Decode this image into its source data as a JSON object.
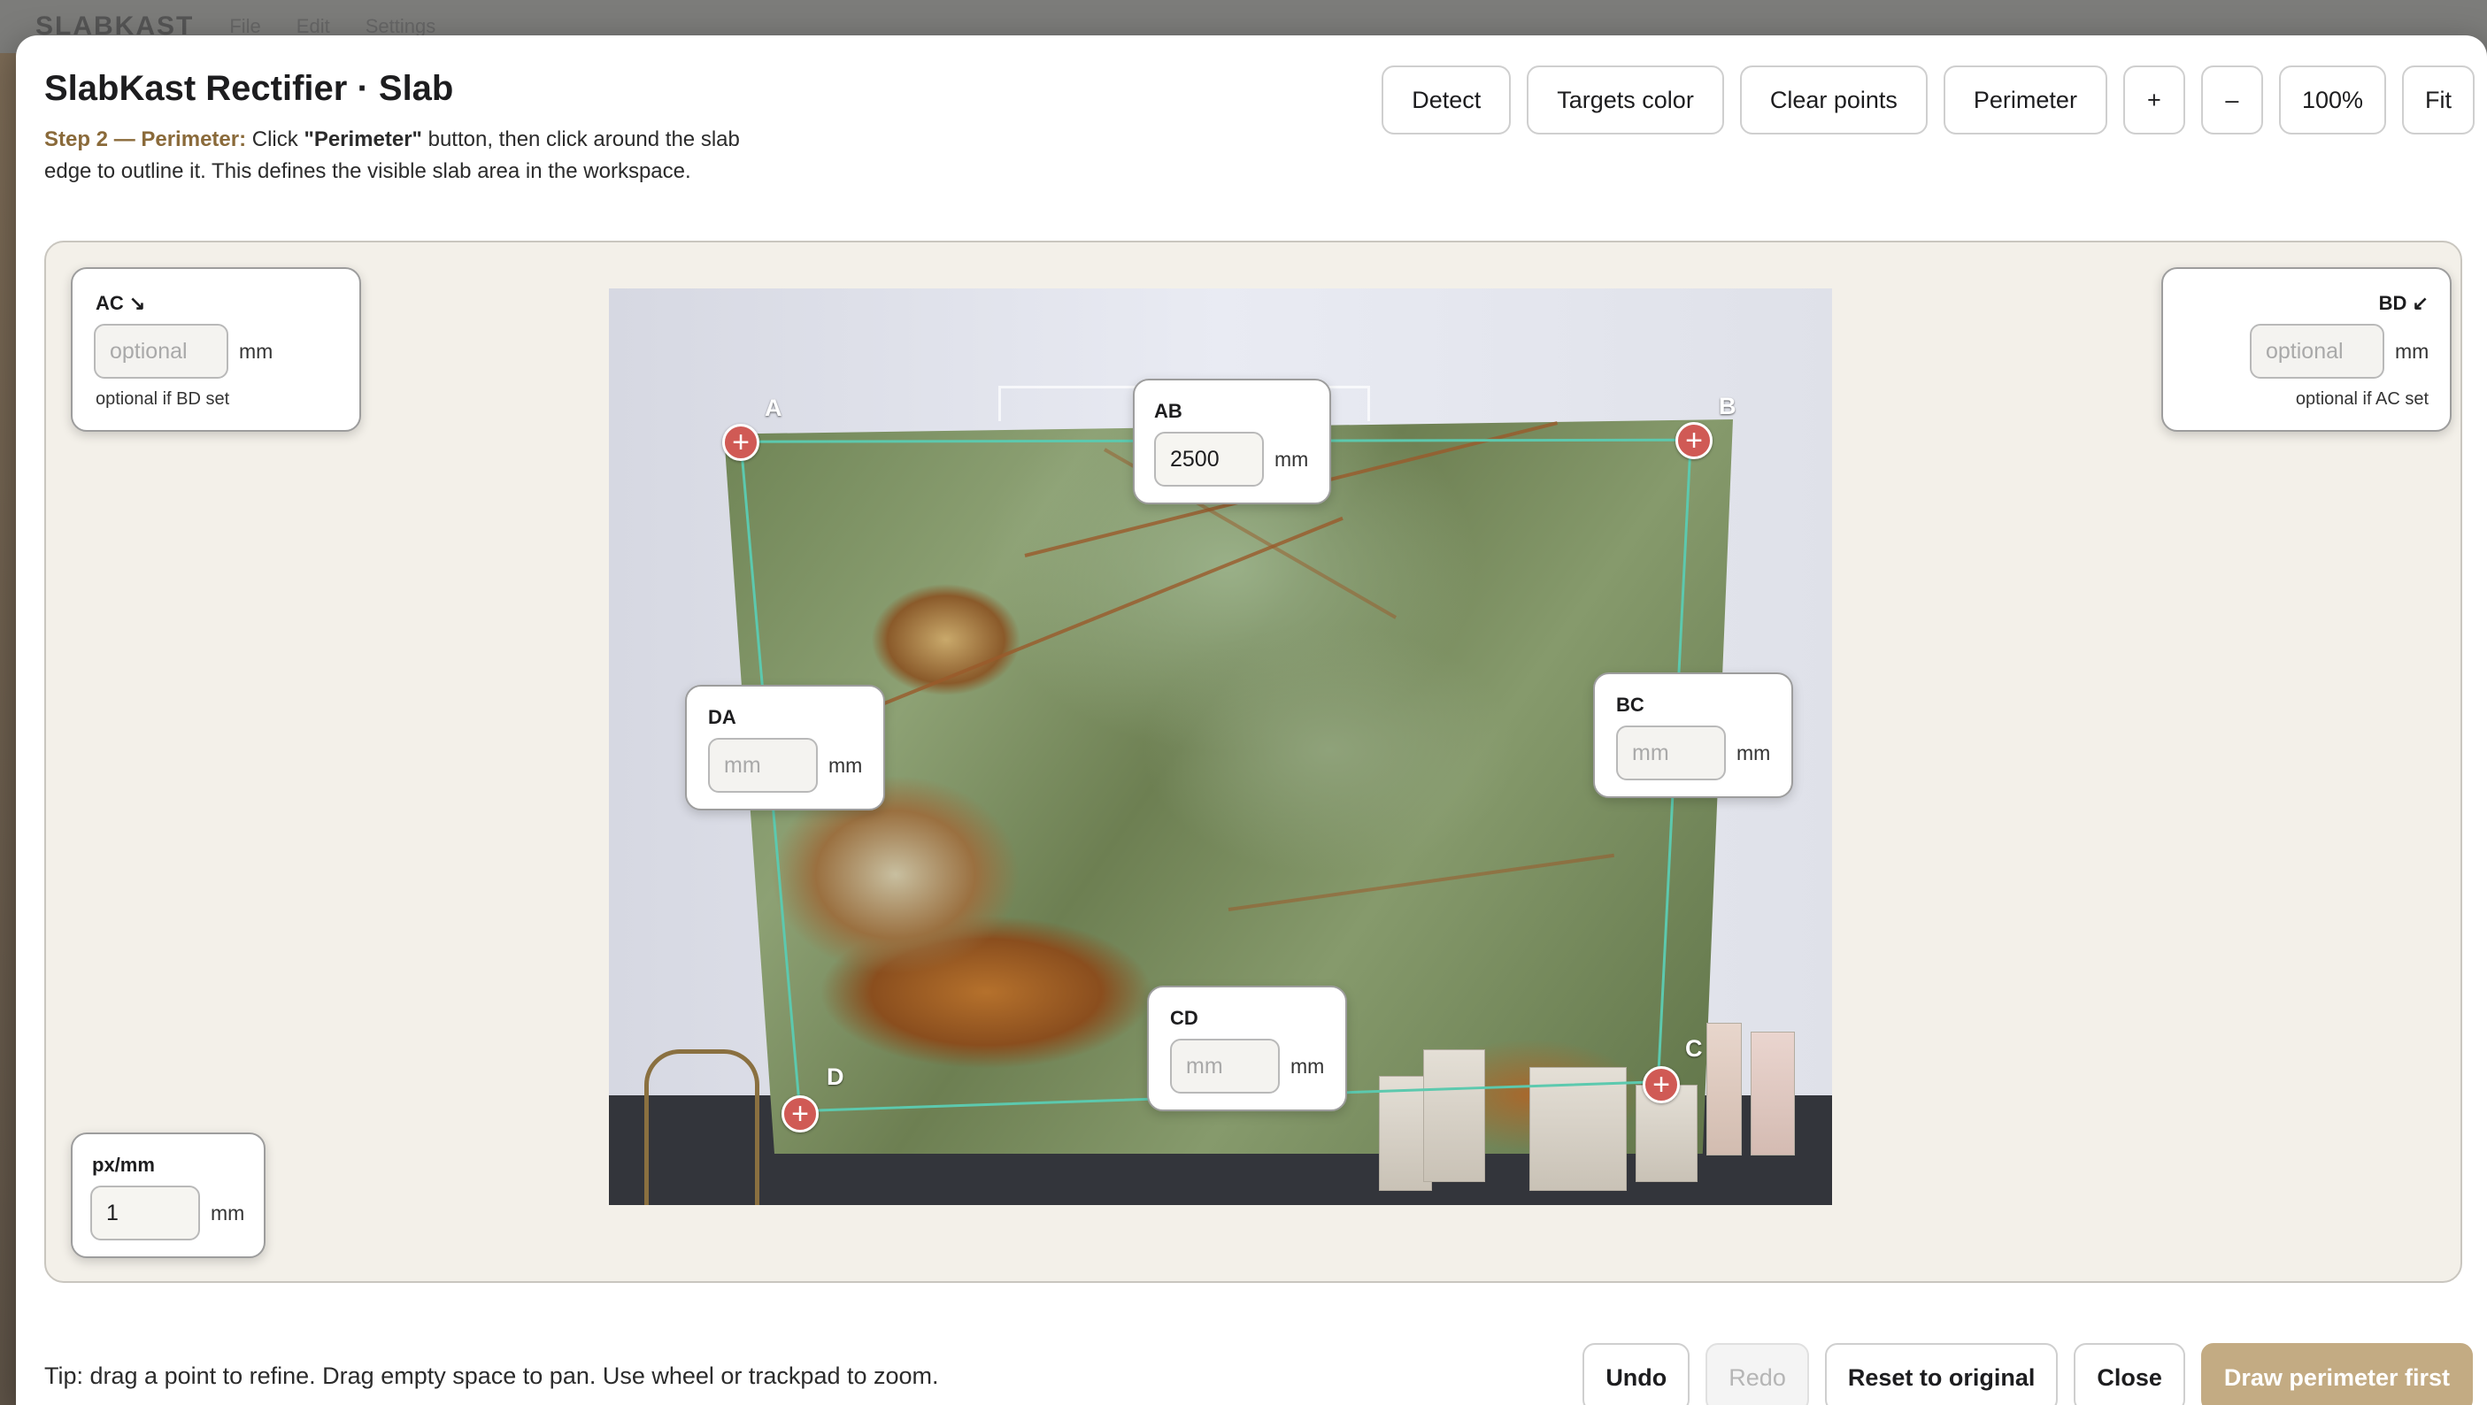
{
  "background_app": {
    "brand": "SLABKAST",
    "menu": [
      "File",
      "Edit",
      "Settings"
    ]
  },
  "dialog": {
    "title": "SlabKast Rectifier · Slab",
    "step_label": "Step 2 — Perimeter:",
    "instruction_pre": "Click",
    "instruction_bold": "\"Perimeter\"",
    "instruction_post": "button, then click around the slab edge to outline it. This defines the visible slab area in the workspace."
  },
  "toolbar": {
    "detect": "Detect",
    "targets_color": "Targets color",
    "clear_points": "Clear points",
    "perimeter": "Perimeter",
    "zoom_in": "+",
    "zoom_out": "–",
    "zoom_level": "100%",
    "fit": "Fit"
  },
  "corners": {
    "a": "A",
    "b": "B",
    "c": "C",
    "d": "D",
    "marker": "+"
  },
  "measurements": {
    "ac": {
      "label": "AC ↘",
      "placeholder": "optional",
      "unit": "mm",
      "hint": "optional if BD set"
    },
    "bd": {
      "label": "BD ↙",
      "placeholder": "optional",
      "unit": "mm",
      "hint": "optional if AC set"
    },
    "ab": {
      "label": "AB",
      "value": "2500",
      "unit": "mm"
    },
    "da": {
      "label": "DA",
      "placeholder": "mm",
      "unit": "mm"
    },
    "bc": {
      "label": "BC",
      "placeholder": "mm",
      "unit": "mm"
    },
    "cd": {
      "label": "CD",
      "placeholder": "mm",
      "unit": "mm"
    },
    "pxmm": {
      "label": "px/mm",
      "value": "1",
      "unit": "mm"
    }
  },
  "colors": {
    "accent": "#8a6a3a",
    "corner_marker": "#d05a55",
    "perimeter_line": "#5cc9ae",
    "primary_button": "#c3ab83"
  },
  "footer": {
    "tip": "Tip: drag a point to refine. Drag empty space to pan. Use wheel or trackpad to zoom.",
    "undo": "Undo",
    "redo": "Redo",
    "reset": "Reset to original",
    "close": "Close",
    "primary": "Draw perimeter first"
  }
}
